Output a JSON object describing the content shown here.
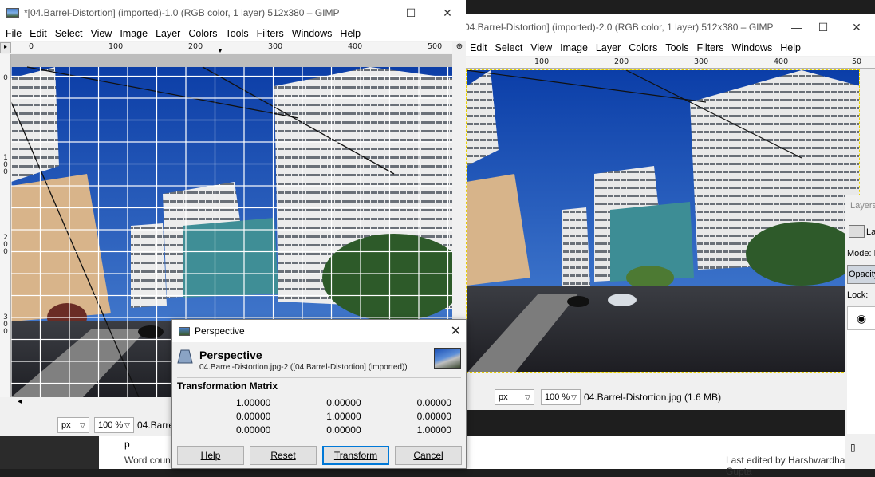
{
  "window1": {
    "title": "*[04.Barrel-Distortion] (imported)-1.0 (RGB color, 1 layer) 512x380 – GIMP",
    "controls": {
      "minimize": "—",
      "maximize": "☐",
      "close": "✕"
    },
    "menu": [
      "File",
      "Edit",
      "Select",
      "View",
      "Image",
      "Layer",
      "Colors",
      "Tools",
      "Filters",
      "Windows",
      "Help"
    ],
    "ruler_labels": [
      "0",
      "100",
      "200",
      "300",
      "400",
      "500"
    ],
    "vruler_labels": [
      "0",
      "100",
      "200",
      "300"
    ],
    "status": {
      "unit": "px",
      "zoom": "100 %",
      "filename": "04.Barre"
    }
  },
  "window2": {
    "title": "04.Barrel-Distortion] (imported)-2.0 (RGB color, 1 layer) 512x380 – GIMP",
    "controls": {
      "minimize": "—",
      "maximize": "☐",
      "close": "✕"
    },
    "menu": [
      "Edit",
      "Select",
      "View",
      "Image",
      "Layer",
      "Colors",
      "Tools",
      "Filters",
      "Windows",
      "Help"
    ],
    "ruler_labels": [
      "100",
      "200",
      "300",
      "400",
      "50"
    ],
    "status": {
      "unit": "px",
      "zoom": "100 %",
      "filename": "04.Barrel-Distortion.jpg (1.6 MB)"
    }
  },
  "dialog": {
    "title": "Perspective",
    "heading": "Perspective",
    "subheading": "04.Barrel-Distortion.jpg-2 ([04.Barrel-Distortion] (imported))",
    "matrix_label": "Transformation Matrix",
    "matrix": [
      [
        "1.00000",
        "0.00000",
        "0.00000"
      ],
      [
        "0.00000",
        "1.00000",
        "0.00000"
      ],
      [
        "0.00000",
        "0.00000",
        "1.00000"
      ]
    ],
    "buttons": {
      "help": "Help",
      "reset": "Reset",
      "transform": "Transform",
      "cancel": "Cancel"
    }
  },
  "layers_panel": {
    "title": "Layers",
    "item": "La",
    "mode": "Mode: N",
    "opacity": "Opacity",
    "lock": "Lock:"
  },
  "background_doc": {
    "line1": "p",
    "word_count": "Word coun",
    "last_edited": "Last edited by Harshwardhan Gupta"
  },
  "colors": {
    "sky": "#2a5fc4",
    "selection": "#0078d7"
  }
}
